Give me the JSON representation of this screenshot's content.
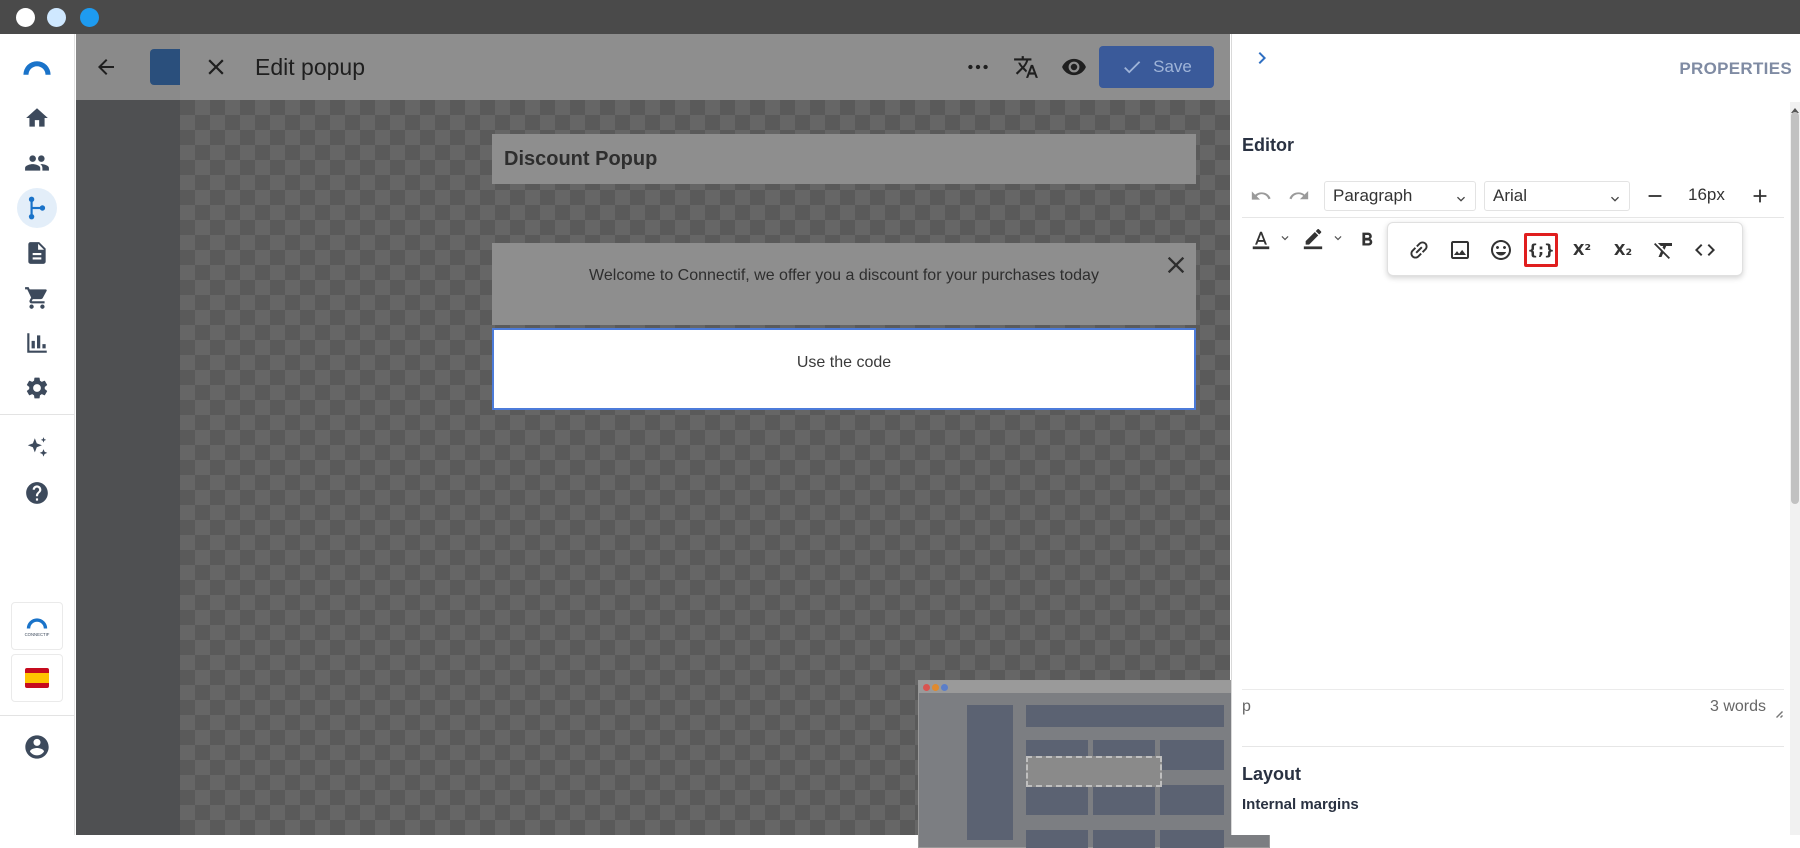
{
  "window": {
    "controls": [
      "close",
      "minimize",
      "zoom"
    ]
  },
  "nav": {
    "items": [
      {
        "name": "home",
        "icon": "home-icon"
      },
      {
        "name": "contacts",
        "icon": "people-icon"
      },
      {
        "name": "workflows",
        "icon": "flow-icon",
        "active": true
      },
      {
        "name": "content",
        "icon": "document-icon"
      },
      {
        "name": "products",
        "icon": "cart-icon"
      },
      {
        "name": "reports",
        "icon": "bar-chart-icon"
      },
      {
        "name": "settings",
        "icon": "gear-icon"
      },
      {
        "name": "ai",
        "icon": "sparkles-icon"
      },
      {
        "name": "help",
        "icon": "help-icon"
      }
    ],
    "brand_logo_text": "CONNECTIF",
    "language_flag": "spain-flag-icon",
    "account_icon": "account-icon"
  },
  "modal": {
    "title": "Edit popup",
    "save_label": "Save",
    "icons": {
      "more": "more-horizontal-icon",
      "translate": "translate-icon",
      "preview": "eye-icon",
      "close": "close-icon"
    }
  },
  "popup": {
    "name": "Discount Popup",
    "welcome_text": "Welcome to Connectif, we offer you a discount for your purchases today",
    "selected_text": "Use the code"
  },
  "properties": {
    "title": "PROPERTIES",
    "editor_label": "Editor",
    "block_format": "Paragraph",
    "font_family": "Arial",
    "font_size": "16px",
    "status_tag": "p",
    "word_count": "3 words",
    "layout_label": "Layout",
    "internal_margins_label": "Internal margins"
  },
  "colors": {
    "accent": "#2f6fc2",
    "save_button": "#3a5a9a",
    "highlight_box": "#e01e1e",
    "selection_border": "#4c7bd9"
  }
}
